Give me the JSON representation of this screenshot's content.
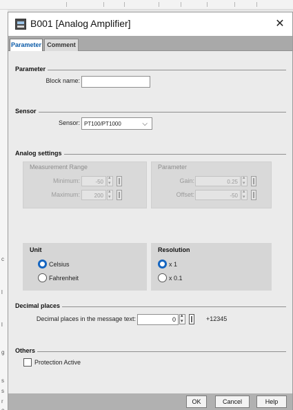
{
  "host": {
    "left_letters": [
      "c",
      "l",
      "g",
      "s",
      "r",
      "o"
    ]
  },
  "dialog": {
    "title": "B001 [Analog Amplifier]",
    "close_glyph": "✕",
    "tabs": [
      {
        "label": "Parameter",
        "active": true
      },
      {
        "label": "Comment",
        "active": false
      }
    ]
  },
  "parameter": {
    "section_title": "Parameter",
    "block_name_label": "Block name:",
    "block_name_value": ""
  },
  "sensor": {
    "section_title": "Sensor",
    "sensor_label": "Sensor:",
    "sensor_value": "PT100/PT1000",
    "chevron": "⌵"
  },
  "analog": {
    "section_title": "Analog settings",
    "measurement": {
      "title": "Measurement Range",
      "min_label": "Minimum:",
      "min_value": "-50",
      "max_label": "Maximum:",
      "max_value": "200"
    },
    "parameter": {
      "title": "Parameter",
      "gain_label": "Gain:",
      "gain_value": "0.25",
      "offset_label": "Offset:",
      "offset_value": "-50"
    }
  },
  "unit": {
    "title": "Unit",
    "options": [
      {
        "label": "Celsius",
        "selected": true
      },
      {
        "label": "Fahrenheit",
        "selected": false
      }
    ]
  },
  "resolution": {
    "title": "Resolution",
    "options": [
      {
        "label": "x 1",
        "selected": true
      },
      {
        "label": "x 0.1",
        "selected": false
      }
    ]
  },
  "decimal": {
    "section_title": "Decimal places",
    "label": "Decimal places in the message text:",
    "value": "0",
    "preview": "+12345"
  },
  "others": {
    "section_title": "Others",
    "protection_label": "Protection Active",
    "protection_checked": false
  },
  "buttons": {
    "ok": "OK",
    "cancel": "Cancel",
    "help": "Help"
  },
  "colors": {
    "accent": "#1565c0",
    "tab_active_text": "#0b5ba8",
    "tabbar": "#a9a9a9",
    "bottombar": "#b1b1b1"
  },
  "icons": {
    "app": "logo-module-icon",
    "close": "close-icon"
  }
}
